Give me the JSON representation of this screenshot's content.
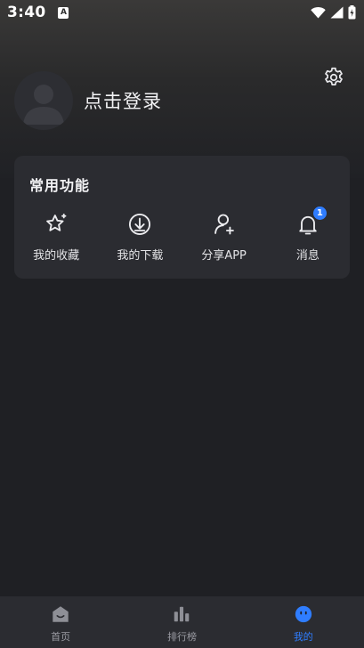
{
  "status_bar": {
    "time": "3:40",
    "notif_glyph": "A"
  },
  "profile": {
    "login_label": "点击登录"
  },
  "common": {
    "title": "常用功能",
    "items": [
      {
        "label": "我的收藏",
        "icon": "star-icon"
      },
      {
        "label": "我的下载",
        "icon": "download-icon"
      },
      {
        "label": "分享APP",
        "icon": "share-user-icon"
      },
      {
        "label": "消息",
        "icon": "bell-icon",
        "badge": "1"
      }
    ]
  },
  "tabs": [
    {
      "label": "首页",
      "icon": "home-icon",
      "active": false
    },
    {
      "label": "排行榜",
      "icon": "ranking-icon",
      "active": false
    },
    {
      "label": "我的",
      "icon": "profile-face-icon",
      "active": true
    }
  ],
  "colors": {
    "accent": "#2f7dff",
    "background": "#1f2024",
    "card": "#2b2c31"
  }
}
